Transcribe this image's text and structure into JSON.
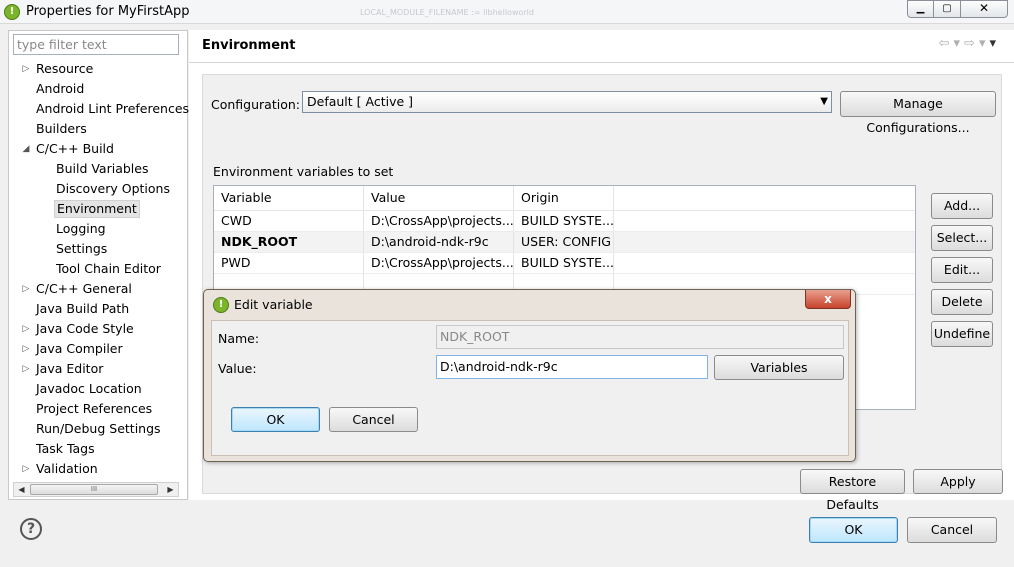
{
  "window": {
    "title": "Properties for MyFirstApp",
    "background_text": "LOCAL_MODULE_FILENAME := libhelloworld",
    "min_icon": "minimize-icon",
    "max_icon": "maximize-icon",
    "close_icon": "close-icon"
  },
  "filter": {
    "placeholder": "type filter text"
  },
  "tree": [
    {
      "label": "Resource",
      "arrow": "▷",
      "level": 0
    },
    {
      "label": "Android",
      "arrow": "",
      "level": 0
    },
    {
      "label": "Android Lint Preferences",
      "arrow": "",
      "level": 0
    },
    {
      "label": "Builders",
      "arrow": "",
      "level": 0
    },
    {
      "label": "C/C++ Build",
      "arrow": "◢",
      "level": 0
    },
    {
      "label": "Build Variables",
      "arrow": "",
      "level": 1
    },
    {
      "label": "Discovery Options",
      "arrow": "",
      "level": 1
    },
    {
      "label": "Environment",
      "arrow": "",
      "level": 1,
      "selected": true
    },
    {
      "label": "Logging",
      "arrow": "",
      "level": 1
    },
    {
      "label": "Settings",
      "arrow": "",
      "level": 1
    },
    {
      "label": "Tool Chain Editor",
      "arrow": "",
      "level": 1
    },
    {
      "label": "C/C++ General",
      "arrow": "▷",
      "level": 0
    },
    {
      "label": "Java Build Path",
      "arrow": "",
      "level": 0
    },
    {
      "label": "Java Code Style",
      "arrow": "▷",
      "level": 0
    },
    {
      "label": "Java Compiler",
      "arrow": "▷",
      "level": 0
    },
    {
      "label": "Java Editor",
      "arrow": "▷",
      "level": 0
    },
    {
      "label": "Javadoc Location",
      "arrow": "",
      "level": 0
    },
    {
      "label": "Project References",
      "arrow": "",
      "level": 0
    },
    {
      "label": "Run/Debug Settings",
      "arrow": "",
      "level": 0
    },
    {
      "label": "Task Tags",
      "arrow": "",
      "level": 0
    },
    {
      "label": "Validation",
      "arrow": "▷",
      "level": 0
    }
  ],
  "scrollbar": {
    "grip": "III"
  },
  "main": {
    "section_title": "Environment",
    "configuration_label": "Configuration:",
    "configuration_value": "Default  [ Active ]",
    "manage_configurations": "Manage Configurations...",
    "env_label": "Environment variables to set",
    "columns": [
      "Variable",
      "Value",
      "Origin"
    ],
    "rows": [
      {
        "variable": "CWD",
        "value": "D:\\CrossApp\\projects...",
        "origin": "BUILD SYSTE..."
      },
      {
        "variable": "NDK_ROOT",
        "value": "D:\\android-ndk-r9c",
        "origin": "USER: CONFIG",
        "selected": true
      },
      {
        "variable": "PWD",
        "value": "D:\\CrossApp\\projects...",
        "origin": "BUILD SYSTE..."
      }
    ],
    "side_buttons": {
      "add": "Add...",
      "select": "Select...",
      "edit": "Edit...",
      "delete": "Delete",
      "undefine": "Undefine"
    },
    "restore_defaults": "Restore Defaults",
    "apply": "Apply"
  },
  "dialog": {
    "title": "Edit variable",
    "close": "x",
    "name_label": "Name:",
    "name_value": "NDK_ROOT",
    "value_label": "Value:",
    "value_value": "D:\\android-ndk-r9c",
    "variables_button": "Variables",
    "ok": "OK",
    "cancel": "Cancel"
  },
  "footer": {
    "help_symbol": "?",
    "ok": "OK",
    "cancel": "Cancel"
  }
}
